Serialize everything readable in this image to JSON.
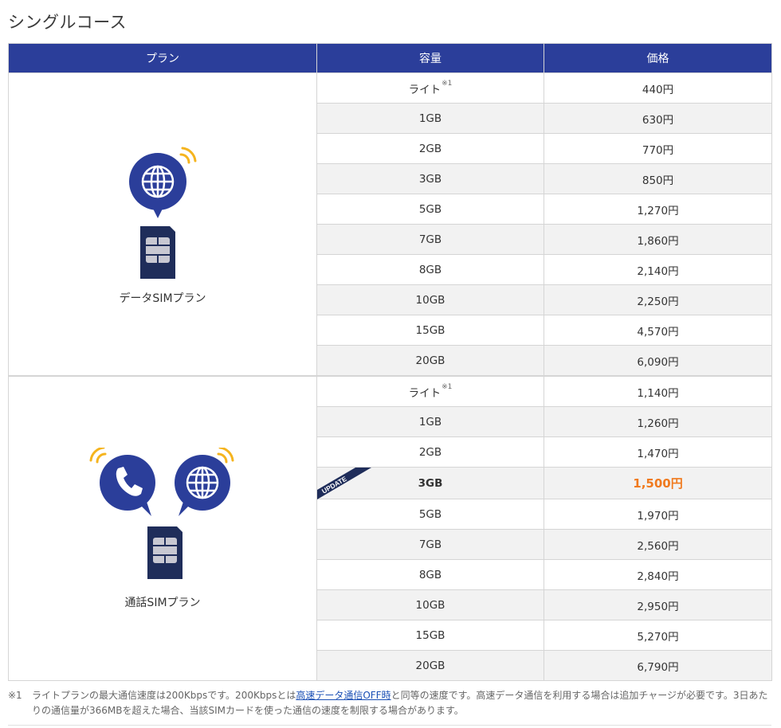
{
  "page_title": "シングルコース",
  "table": {
    "headers": {
      "plan": "プラン",
      "capacity": "容量",
      "price": "価格"
    },
    "data_plan": {
      "label": "データSIMプラン",
      "icons": [
        "globe-bubble-icon",
        "signal-waves-icon",
        "sim-card-icon"
      ],
      "rows": [
        {
          "capacity": "ライト",
          "note": "※1",
          "price": "440円"
        },
        {
          "capacity": "1GB",
          "price": "630円"
        },
        {
          "capacity": "2GB",
          "price": "770円"
        },
        {
          "capacity": "3GB",
          "price": "850円"
        },
        {
          "capacity": "5GB",
          "price": "1,270円"
        },
        {
          "capacity": "7GB",
          "price": "1,860円"
        },
        {
          "capacity": "8GB",
          "price": "2,140円"
        },
        {
          "capacity": "10GB",
          "price": "2,250円"
        },
        {
          "capacity": "15GB",
          "price": "4,570円"
        },
        {
          "capacity": "20GB",
          "price": "6,090円"
        }
      ]
    },
    "voice_plan": {
      "label": "通話SIMプラン",
      "icons": [
        "phone-bubble-icon",
        "globe-bubble-icon",
        "signal-waves-icon",
        "sim-card-icon"
      ],
      "rows": [
        {
          "capacity": "ライト",
          "note": "※1",
          "price": "1,140円"
        },
        {
          "capacity": "1GB",
          "price": "1,260円"
        },
        {
          "capacity": "2GB",
          "price": "1,470円"
        },
        {
          "capacity": "3GB",
          "price": "1,500円",
          "badge": "UPDATE",
          "highlight": true
        },
        {
          "capacity": "5GB",
          "price": "1,970円"
        },
        {
          "capacity": "7GB",
          "price": "2,560円"
        },
        {
          "capacity": "8GB",
          "price": "2,840円"
        },
        {
          "capacity": "10GB",
          "price": "2,950円"
        },
        {
          "capacity": "15GB",
          "price": "5,270円"
        },
        {
          "capacity": "20GB",
          "price": "6,790円"
        }
      ]
    }
  },
  "footnote": {
    "mark": "※1",
    "text_before": "ライトプランの最大通信速度は200Kbpsです。200Kbpsとは",
    "link_text": "高速データ通信OFF時",
    "text_after": "と同等の速度です。高速データ通信を利用する場合は追加チャージが必要です。3日あたりの通信量が366MBを超えた場合、当該SIMカードを使った通信の速度を制限する場合があります。"
  },
  "colors": {
    "header_bg": "#2b3e9a",
    "icon_navy": "#2b3e9a",
    "sim_navy": "#1f2d5a",
    "signal_yellow": "#f5b41e",
    "highlight_price": "#f07a1e",
    "row_alt": "#f2f2f2",
    "link": "#1a4fb5"
  }
}
